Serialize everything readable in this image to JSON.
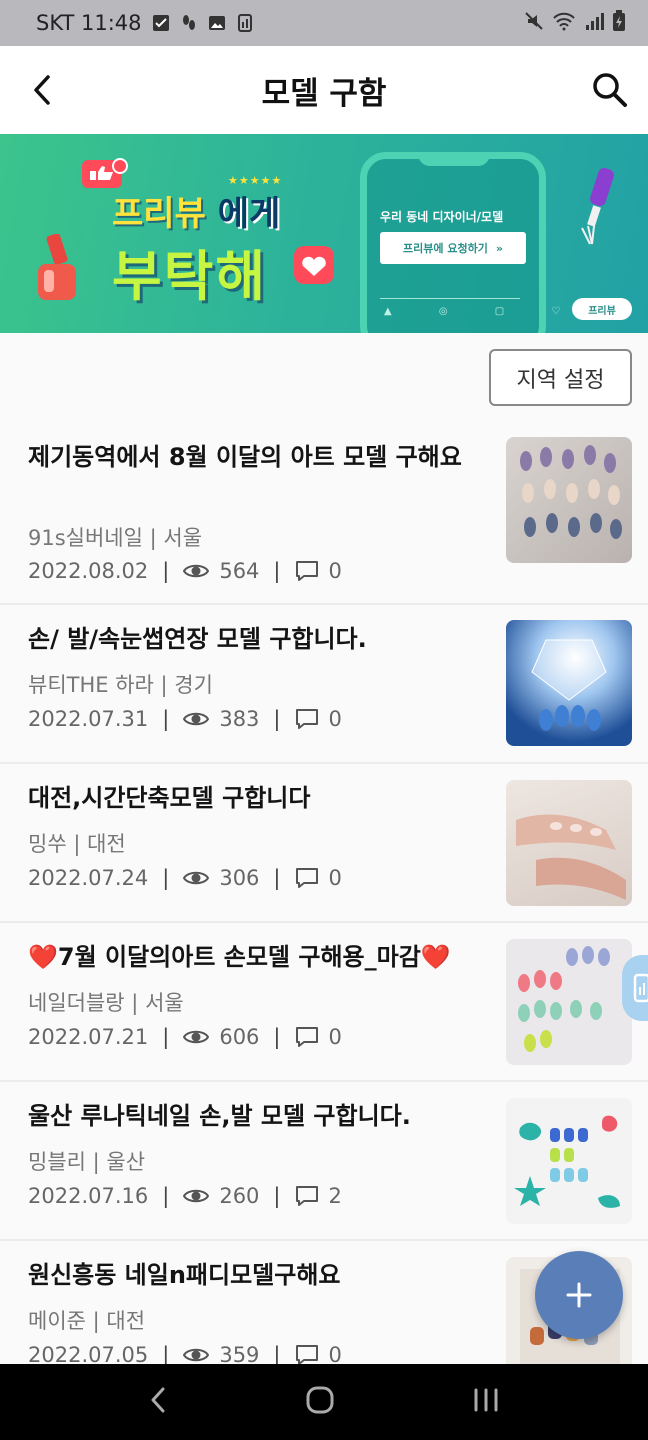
{
  "status_bar": {
    "carrier_time": "SKT 11:48",
    "icons_left": [
      "check-box-icon",
      "footprints-icon",
      "image-icon",
      "memo-icon"
    ],
    "icons_right": [
      "mute-icon",
      "wifi-icon",
      "signal-icon",
      "battery-icon"
    ]
  },
  "header": {
    "title": "모델 구함",
    "back_icon": "chevron-left-icon",
    "search_icon": "search-icon"
  },
  "banner": {
    "line_a": "프리뷰",
    "line_b": "에게",
    "line_c": "부탁해",
    "phone_text": "우리 동네 디자이너/모델",
    "phone_button": "프리뷰에 요청하기",
    "tag": "프리뷰"
  },
  "filter": {
    "region_button": "지역 설정"
  },
  "posts": [
    {
      "title": "제기동역에서 8월 이달의 아트 모델 구해요",
      "author": "91s실버네일",
      "region": "서울",
      "date": "2022.08.02",
      "views": "564",
      "comments": "0",
      "colors": [
        "#c9c4c0",
        "#8a7aa8",
        "#d8b9a0",
        "#e9e3de"
      ]
    },
    {
      "title": "손/ 발/속눈썹연장 모델 구합니다.",
      "author": "뷰티THE 하라",
      "region": "경기",
      "date": "2022.07.31",
      "views": "383",
      "comments": "0",
      "colors": [
        "#1e4f9a",
        "#6aa6e0",
        "#dfe9f5",
        "#2d6fc0"
      ]
    },
    {
      "title": "대전,시간단축모델 구합니다",
      "author": "밍쑤",
      "region": "대전",
      "date": "2022.07.24",
      "views": "306",
      "comments": "0",
      "colors": [
        "#e3d6cf",
        "#d59a8a",
        "#f1e8e2",
        "#c48476"
      ]
    },
    {
      "title": "❤️7월 이달의아트 손모델 구해용_마감❤️",
      "author": "네일더블랑",
      "region": "서울",
      "date": "2022.07.21",
      "views": "606",
      "comments": "0",
      "colors": [
        "#e8e4ea",
        "#8fd0b8",
        "#c9e04a",
        "#9aa7d6"
      ]
    },
    {
      "title": "울산 루나틱네일 손,발 모델 구합니다.",
      "author": "밍블리",
      "region": "울산",
      "date": "2022.07.16",
      "views": "260",
      "comments": "2",
      "colors": [
        "#f2f2f2",
        "#2bb3a8",
        "#3d6ad1",
        "#b8e04a"
      ]
    },
    {
      "title": "원신흥동 네일n패디모델구해요",
      "author": "메이준",
      "region": "대전",
      "date": "2022.07.05",
      "views": "359",
      "comments": "0",
      "colors": [
        "#f0ece8",
        "#c56a3a",
        "#3a3f6a",
        "#e8a24a"
      ]
    }
  ],
  "fab": {
    "icon": "plus-icon"
  },
  "nav": {
    "icons": [
      "back-nav-icon",
      "home-nav-icon",
      "recents-nav-icon"
    ]
  }
}
